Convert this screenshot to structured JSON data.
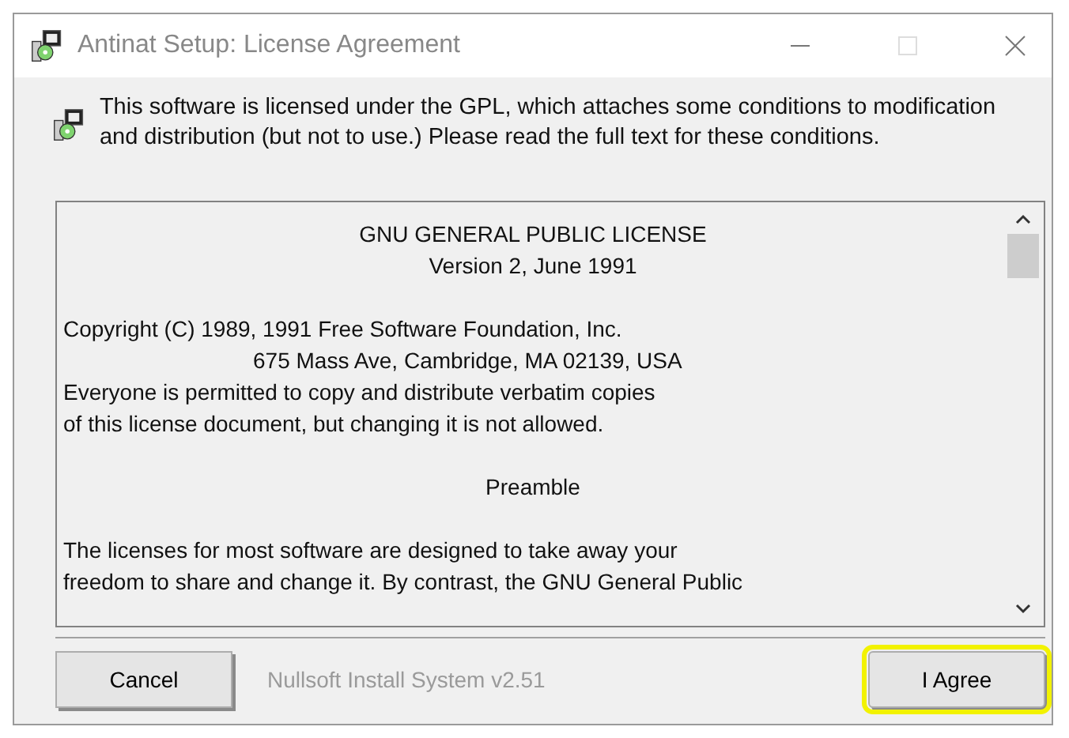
{
  "window": {
    "title": "Antinat Setup: License Agreement",
    "maximize_disabled": true
  },
  "header": {
    "text": "This software is licensed under the GPL, which attaches some conditions to modification and distribution (but not to use.)  Please read the full text for these conditions."
  },
  "license_text": {
    "lines": [
      {
        "text": "GNU GENERAL PUBLIC LICENSE",
        "kind": "center"
      },
      {
        "text": "Version 2, June 1991",
        "kind": "center"
      },
      {
        "kind": "blank"
      },
      {
        "text": "Copyright (C) 1989, 1991 Free Software Foundation, Inc.",
        "kind": "left"
      },
      {
        "text": "675 Mass Ave, Cambridge, MA 02139, USA",
        "kind": "indent"
      },
      {
        "text": "Everyone is permitted to copy and distribute verbatim copies",
        "kind": "left"
      },
      {
        "text": "of this license document, but changing it is not allowed.",
        "kind": "left"
      },
      {
        "kind": "blank"
      },
      {
        "text": "Preamble",
        "kind": "center"
      },
      {
        "kind": "blank"
      },
      {
        "text": "The licenses for most software are designed to take away your",
        "kind": "left"
      },
      {
        "text": "freedom to share and change it.  By contrast, the GNU General Public",
        "kind": "left"
      }
    ]
  },
  "footer": {
    "branding": "Nullsoft Install System v2.51",
    "buttons": [
      {
        "label": "Cancel",
        "highlighted": false
      },
      {
        "label": "I Agree",
        "highlighted": true
      }
    ]
  }
}
